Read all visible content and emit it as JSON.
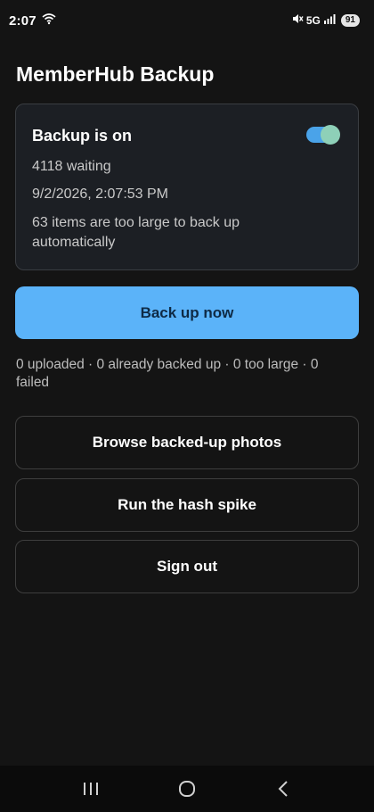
{
  "status_bar": {
    "time": "2:07",
    "network": "5G",
    "battery": "91"
  },
  "page": {
    "title": "MemberHub Backup"
  },
  "backup_card": {
    "title": "Backup is on",
    "toggle_on": true,
    "waiting": "4118 waiting",
    "timestamp": "9/2/2026, 2:07:53 PM",
    "large_items_note": "63 items are too large to back up automatically"
  },
  "actions": {
    "backup_now_label": "Back up now",
    "summary": "0 uploaded · 0 already backed up · 0 too large · 0 failed",
    "browse_label": "Browse backed-up photos",
    "hash_spike_label": "Run the hash spike",
    "sign_out_label": "Sign out"
  },
  "colors": {
    "background": "#141414",
    "accent": "#5bb3f9",
    "card": "#1c1f24"
  },
  "icons": {
    "wifi": "wifi-icon",
    "mute": "mute-icon",
    "signal": "signal-icon",
    "recents": "recents-icon",
    "home": "home-icon",
    "back": "back-icon"
  }
}
